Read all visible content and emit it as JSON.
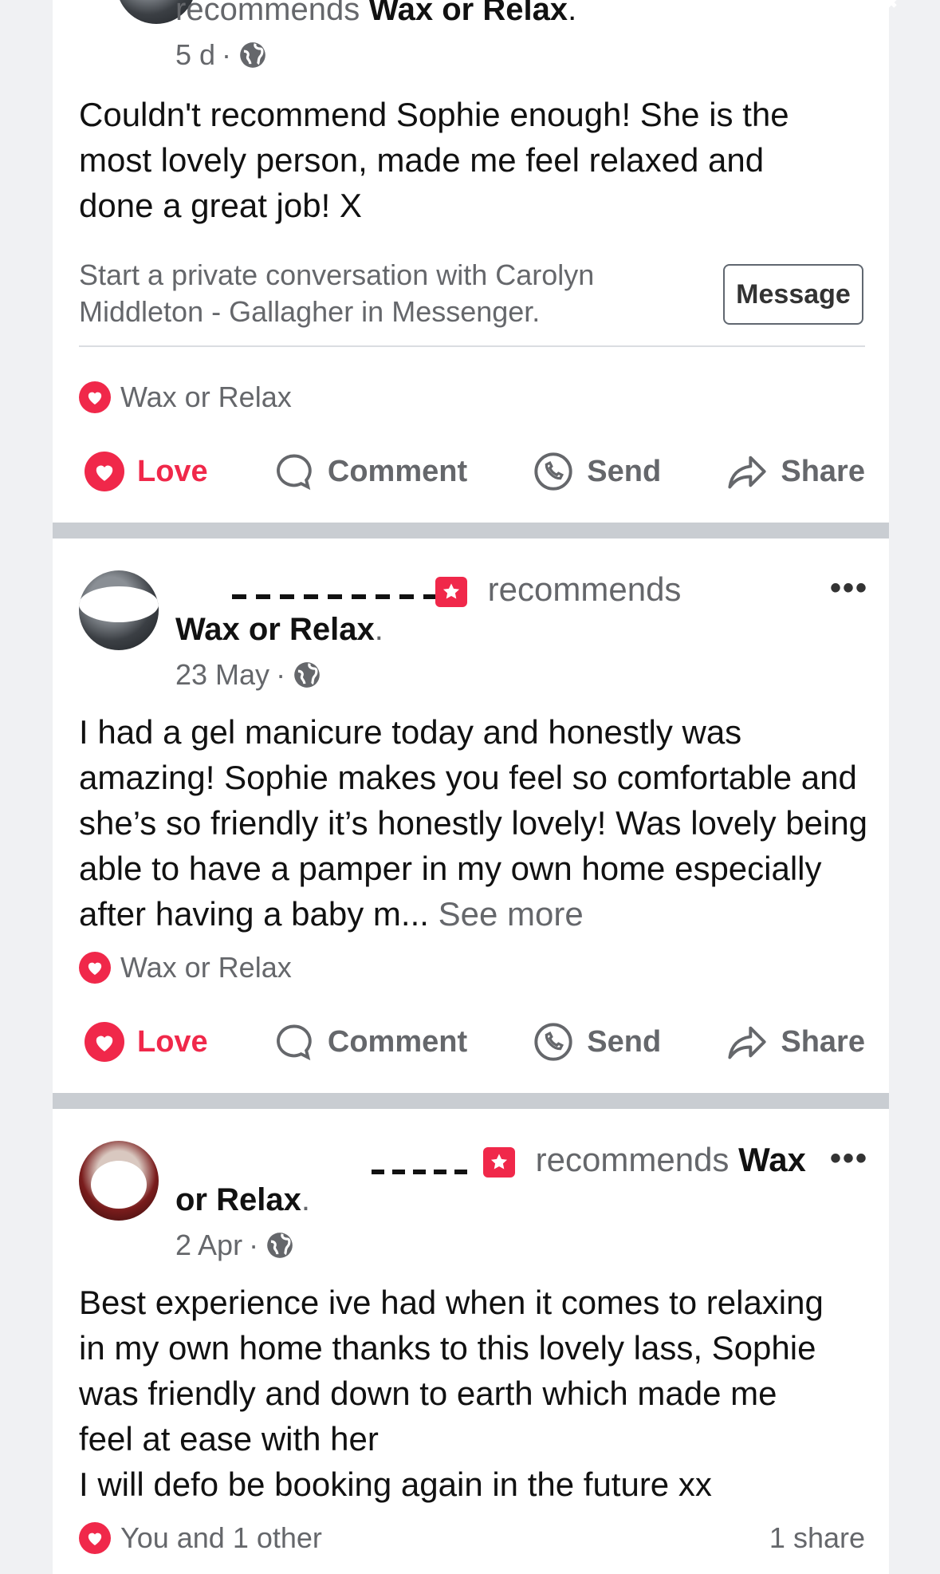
{
  "post1": {
    "recommends_text": "recommends",
    "page_name": "Wax or Relax",
    "time": "5 d",
    "body": "Couldn't recommend Sophie enough! She is the most lovely person, made me feel relaxed and done a great job! X",
    "message_prompt_line1": "Start a private conversation with Carolyn",
    "message_prompt_line2": "Middleton - Gallagher in Messenger.",
    "message_button": "Message",
    "reaction_text": "Wax or Relax",
    "actions": {
      "love": "Love",
      "comment": "Comment",
      "send": "Send",
      "share": "Share"
    }
  },
  "post2": {
    "recommends_text": "recommends",
    "page_name": "Wax or Relax",
    "time": "23 May",
    "body": "I had a gel manicure today and honestly was amazing! Sophie makes you feel so comfortable and she’s so friendly it’s honestly lovely! Was lovely being able to have a pamper in my own home especially after having a baby m...",
    "see_more": "See more",
    "reaction_text": "Wax or Relax",
    "actions": {
      "love": "Love",
      "comment": "Comment",
      "send": "Send",
      "share": "Share"
    }
  },
  "post3": {
    "recommends_text": "recommends",
    "page_name_part1": "Wax",
    "page_name_part2": "or Relax",
    "time": "2 Apr",
    "body_line1": "Best experience ive had when it comes to relaxing",
    "body_line2": "in my own home thanks to this lovely lass, Sophie",
    "body_line3": "was friendly and down to earth which made me",
    "body_line4": "feel at ease with her",
    "body_line5": "I will defo be booking again in the future xx",
    "reaction_text": "You and 1 other",
    "shares": "1 share"
  },
  "colors": {
    "love": "#f0284a",
    "muted": "#65676b",
    "separator": "#c9cdd2"
  },
  "icons": [
    "globe-icon",
    "heart-icon",
    "comment-icon",
    "send-icon",
    "share-icon",
    "more-icon",
    "recommend-icon",
    "close-icon"
  ]
}
